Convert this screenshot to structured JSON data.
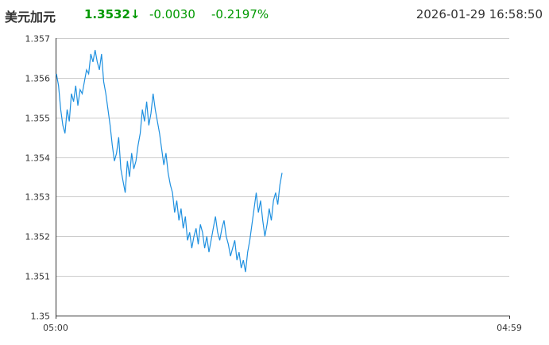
{
  "header": {
    "name": "美元加元",
    "price": "1.3532",
    "arrow": "↓",
    "change": "-0.0030",
    "change_pct": "-0.2197%",
    "datetime": "2026-01-29 16:58:50",
    "down_color": "#009900"
  },
  "chart_data": {
    "type": "line",
    "title": "",
    "xlabel": "",
    "ylabel": "",
    "y_ticks": [
      "1.357",
      "1.356",
      "1.355",
      "1.354",
      "1.353",
      "1.352",
      "1.351",
      "1.35"
    ],
    "x_ticks": [
      "05:00",
      "04:59"
    ],
    "ylim": [
      1.35,
      1.357
    ],
    "grid": true,
    "line_color": "#1e90e0",
    "series": [
      {
        "values": [
          1.3561,
          1.3558,
          1.3552,
          1.3548,
          1.3546,
          1.3552,
          1.3549,
          1.3556,
          1.3554,
          1.3558,
          1.3553,
          1.3557,
          1.3556,
          1.3559,
          1.3562,
          1.3561,
          1.3566,
          1.3564,
          1.3567,
          1.3564,
          1.3562,
          1.3566,
          1.3559,
          1.3556,
          1.3552,
          1.3548,
          1.3543,
          1.3539,
          1.3541,
          1.3545,
          1.3537,
          1.3534,
          1.3531,
          1.3539,
          1.3535,
          1.3541,
          1.3537,
          1.3539,
          1.3543,
          1.3546,
          1.3552,
          1.3549,
          1.3554,
          1.3548,
          1.3551,
          1.3556,
          1.3552,
          1.3549,
          1.3546,
          1.3542,
          1.3538,
          1.3541,
          1.3536,
          1.3533,
          1.3531,
          1.3526,
          1.3529,
          1.3524,
          1.3527,
          1.3522,
          1.3525,
          1.3519,
          1.3521,
          1.3517,
          1.352,
          1.3522,
          1.3518,
          1.3523,
          1.3521,
          1.3517,
          1.352,
          1.3516,
          1.3519,
          1.3522,
          1.3525,
          1.3521,
          1.3519,
          1.3522,
          1.3524,
          1.352,
          1.3518,
          1.3515,
          1.3517,
          1.3519,
          1.3514,
          1.3516,
          1.3512,
          1.3514,
          1.3511,
          1.3516,
          1.3519,
          1.3523,
          1.3527,
          1.3531,
          1.3526,
          1.3529,
          1.3524,
          1.352,
          1.3523,
          1.3527,
          1.3524,
          1.3529,
          1.3531,
          1.3528,
          1.3533,
          1.3536
        ]
      }
    ]
  }
}
